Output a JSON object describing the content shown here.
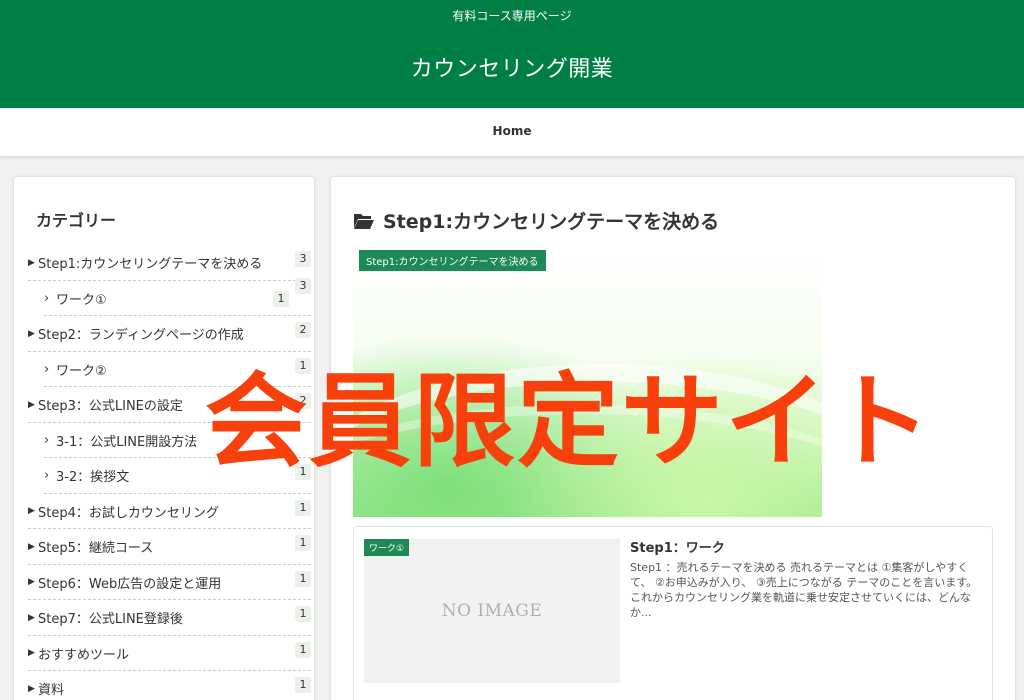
{
  "header": {
    "sub_title": "有料コース専用ページ",
    "site_title": "カウンセリング開業",
    "bg_color": "#007f45"
  },
  "nav": {
    "home": "Home"
  },
  "sidebar": {
    "heading": "カテゴリー",
    "items": [
      {
        "label": "Step1:カウンセリングテーマを決める",
        "count": "3",
        "sub": false
      },
      {
        "label": "ワーク①",
        "count": "1",
        "sub": true
      },
      {
        "label": "Step2：ランディングページの作成",
        "count": "2",
        "sub": false
      },
      {
        "label": "ワーク②",
        "count": "1",
        "sub": true
      },
      {
        "label": "Step3：公式LINEの設定",
        "count": "2",
        "sub": false
      },
      {
        "label": "3-1：公式LINE開設方法",
        "count": "",
        "sub": true
      },
      {
        "label": "3-2：挨拶文",
        "count": "1",
        "sub": true
      },
      {
        "label": "Step4：お試しカウンセリング",
        "count": "1",
        "sub": false
      },
      {
        "label": "Step5：継続コース",
        "count": "1",
        "sub": false
      },
      {
        "label": "Step6：Web広告の設定と運用",
        "count": "1",
        "sub": false
      },
      {
        "label": "Step7：公式LINE登録後",
        "count": "1",
        "sub": false
      },
      {
        "label": "おすすめツール",
        "count": "1",
        "sub": false
      },
      {
        "label": "資料",
        "count": "1",
        "sub": false
      }
    ]
  },
  "main": {
    "title": "Step1:カウンセリングテーマを決める",
    "hero_label": "Step1:カウンセリングテーマを決める",
    "post": {
      "label": "ワーク①",
      "thumb_text": "NO IMAGE",
      "title": "Step1：ワーク",
      "excerpt": "Step1 ：売れるテーマを決める 売れるテーマとは ①集客がしやすくて、 ②お申込みが入り、 ③売上につながる テーマのことを言います。 これからカウンセリング業を軌道に乗せ安定させていくには、どんなか..."
    }
  },
  "overlay": {
    "text": "会員限定サイト",
    "color": "#f7400b"
  }
}
